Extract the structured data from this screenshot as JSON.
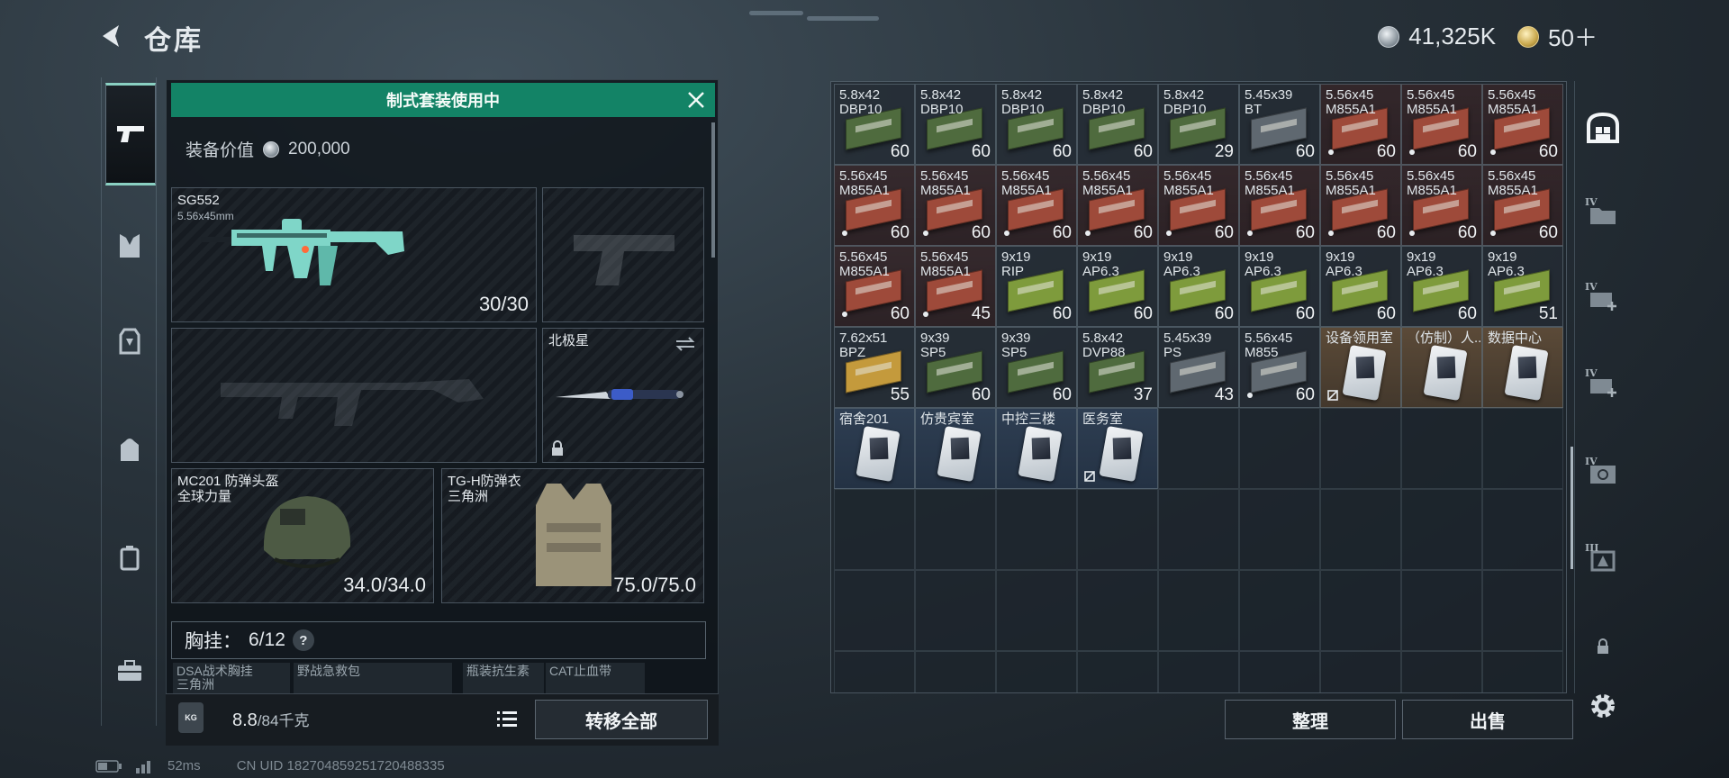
{
  "header": {
    "title": "仓库",
    "currency1": "41,325K",
    "currency2": "50＋"
  },
  "loadout": {
    "banner": "制式套装使用中",
    "value_label": "装备价值",
    "value": "200,000",
    "primary": {
      "name": "SG552",
      "caliber": "5.56x45mm",
      "ammo": "30/30"
    },
    "melee": {
      "name": "北极星"
    },
    "helmet": {
      "name": "MC201 防弹头盔",
      "origin": "全球力量",
      "durability": "34.0/34.0"
    },
    "armor": {
      "name": "TG-H防弹衣",
      "origin": "三角洲",
      "durability": "75.0/75.0"
    },
    "chest_rig": {
      "label": "胸挂：",
      "capacity": "6/12",
      "help": "?"
    },
    "pouch_items": [
      "DSA战术胸挂",
      "三角洲",
      "野战急救包",
      "瓶装抗生素",
      "CAT止血带"
    ],
    "weight": "8.8",
    "weight_max": "/84千克",
    "kg_icon_text": "KG",
    "transfer_label": "转移全部"
  },
  "inventory": {
    "rows": [
      [
        {
          "n1": "5.8x42",
          "n2": "DBP10",
          "c": "60",
          "t": "green"
        },
        {
          "n1": "5.8x42",
          "n2": "DBP10",
          "c": "60",
          "t": "green"
        },
        {
          "n1": "5.8x42",
          "n2": "DBP10",
          "c": "60",
          "t": "green"
        },
        {
          "n1": "5.8x42",
          "n2": "DBP10",
          "c": "60",
          "t": "green"
        },
        {
          "n1": "5.8x42",
          "n2": "DBP10",
          "c": "29",
          "t": "green"
        },
        {
          "n1": "5.45x39",
          "n2": "BT",
          "c": "60",
          "t": "gray"
        },
        {
          "n1": "5.56x45",
          "n2": "M855A1",
          "c": "60",
          "t": "red",
          "d": true
        },
        {
          "n1": "5.56x45",
          "n2": "M855A1",
          "c": "60",
          "t": "red",
          "d": true
        },
        {
          "n1": "5.56x45",
          "n2": "M855A1",
          "c": "60",
          "t": "red",
          "d": true
        }
      ],
      [
        {
          "n1": "5.56x45",
          "n2": "M855A1",
          "c": "60",
          "t": "red",
          "d": true
        },
        {
          "n1": "5.56x45",
          "n2": "M855A1",
          "c": "60",
          "t": "red",
          "d": true
        },
        {
          "n1": "5.56x45",
          "n2": "M855A1",
          "c": "60",
          "t": "red",
          "d": true
        },
        {
          "n1": "5.56x45",
          "n2": "M855A1",
          "c": "60",
          "t": "red",
          "d": true
        },
        {
          "n1": "5.56x45",
          "n2": "M855A1",
          "c": "60",
          "t": "red",
          "d": true
        },
        {
          "n1": "5.56x45",
          "n2": "M855A1",
          "c": "60",
          "t": "red",
          "d": true
        },
        {
          "n1": "5.56x45",
          "n2": "M855A1",
          "c": "60",
          "t": "red",
          "d": true
        },
        {
          "n1": "5.56x45",
          "n2": "M855A1",
          "c": "60",
          "t": "red",
          "d": true
        },
        {
          "n1": "5.56x45",
          "n2": "M855A1",
          "c": "60",
          "t": "red",
          "d": true
        }
      ],
      [
        {
          "n1": "5.56x45",
          "n2": "M855A1",
          "c": "60",
          "t": "red",
          "d": true
        },
        {
          "n1": "5.56x45",
          "n2": "M855A1",
          "c": "45",
          "t": "red",
          "d": true
        },
        {
          "n1": "9x19",
          "n2": "RIP",
          "c": "60",
          "t": "lime"
        },
        {
          "n1": "9x19",
          "n2": "AP6.3",
          "c": "60",
          "t": "lime"
        },
        {
          "n1": "9x19",
          "n2": "AP6.3",
          "c": "60",
          "t": "lime"
        },
        {
          "n1": "9x19",
          "n2": "AP6.3",
          "c": "60",
          "t": "lime"
        },
        {
          "n1": "9x19",
          "n2": "AP6.3",
          "c": "60",
          "t": "lime"
        },
        {
          "n1": "9x19",
          "n2": "AP6.3",
          "c": "60",
          "t": "lime"
        },
        {
          "n1": "9x19",
          "n2": "AP6.3",
          "c": "51",
          "t": "lime"
        }
      ],
      [
        {
          "n1": "7.62x51",
          "n2": "BPZ",
          "c": "55",
          "t": "yellow"
        },
        {
          "n1": "9x39",
          "n2": "SP5",
          "c": "60",
          "t": "green"
        },
        {
          "n1": "9x39",
          "n2": "SP5",
          "c": "60",
          "t": "green"
        },
        {
          "n1": "5.8x42",
          "n2": "DVP88",
          "c": "37",
          "t": "green"
        },
        {
          "n1": "5.45x39",
          "n2": "PS",
          "c": "43",
          "t": "gray"
        },
        {
          "n1": "5.56x45",
          "n2": "M855",
          "c": "60",
          "t": "gray",
          "d": true
        },
        {
          "n1": "设备领用室",
          "card": true,
          "bg": "gold",
          "lock": true
        },
        {
          "n1": "（仿制）人...",
          "card": true,
          "bg": "gold"
        },
        {
          "n1": "数据中心",
          "card": true,
          "bg": "gold"
        }
      ],
      [
        {
          "n1": "宿舍201",
          "card": true,
          "bg": "blue"
        },
        {
          "n1": "仿贵宾室",
          "card": true,
          "bg": "blue"
        },
        {
          "n1": "中控三楼",
          "card": true,
          "bg": "blue"
        },
        {
          "n1": "医务室",
          "card": true,
          "bg": "blue",
          "lock": true
        }
      ]
    ],
    "sort_label": "整理",
    "sell_label": "出售"
  },
  "right_tabs": [
    {
      "icon": "warehouse-icon",
      "roman": ""
    },
    {
      "icon": "folder-icon",
      "roman": "IV"
    },
    {
      "icon": "add-storage-icon",
      "roman": "IV"
    },
    {
      "icon": "add-storage-icon",
      "roman": "IV"
    },
    {
      "icon": "safe-icon",
      "roman": "IV"
    },
    {
      "icon": "crate-icon",
      "roman": "III"
    }
  ],
  "status": {
    "ping": "52ms",
    "uid": "CN UID 182704859251720488335"
  },
  "colors": {
    "accent": "#138366",
    "teal_weapon": "#7fd6c8"
  }
}
